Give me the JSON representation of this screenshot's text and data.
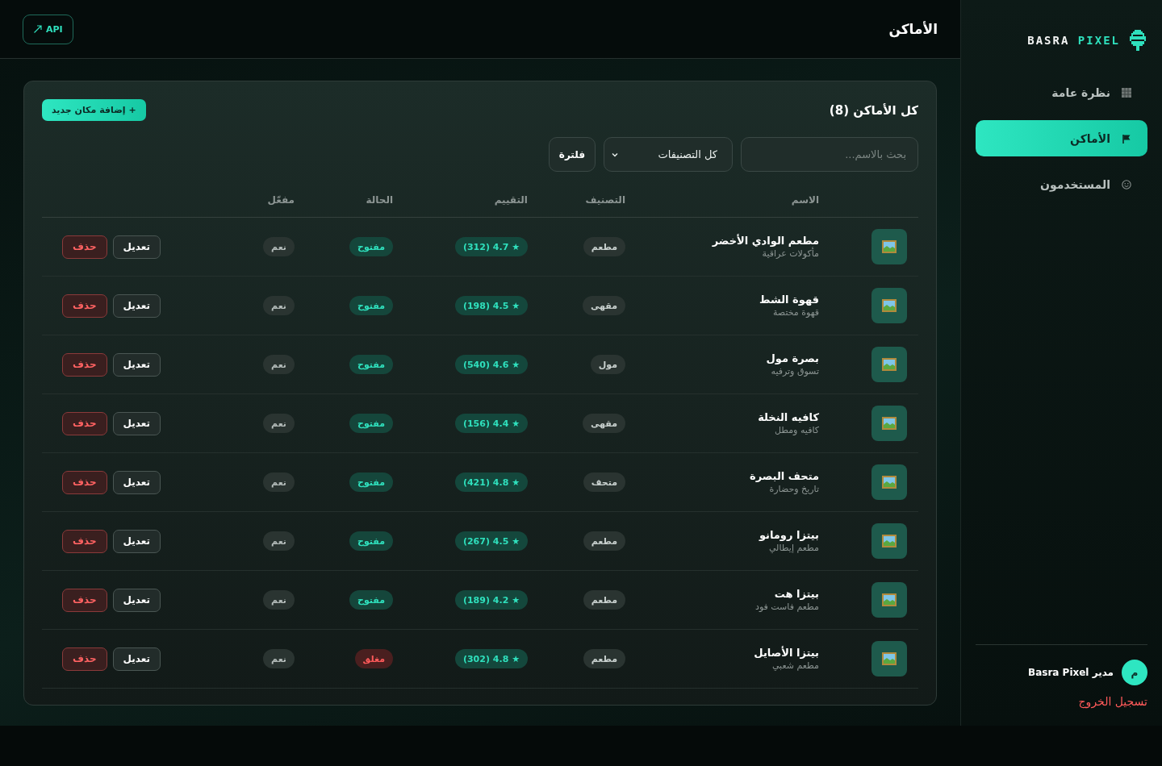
{
  "sidebar": {
    "logo": {
      "word_1": "BASRA",
      "word_2": "PIXEL"
    },
    "items": [
      {
        "label": "نظرة عامة",
        "selected": false
      },
      {
        "label": "الأماكن",
        "selected": true
      },
      {
        "label": "المستخدمون",
        "selected": false
      }
    ],
    "user": {
      "initial": "م",
      "name": "مدير Basra Pixel"
    },
    "logout": "تسجيل الخروج"
  },
  "header": {
    "title": "الأماكن",
    "api_button": "API"
  },
  "card": {
    "title": "كل الأماكن (8)",
    "add_button": "+ إضافة مكان جديد",
    "search": {
      "placeholder": "بحث بالاسم..."
    },
    "category_select": "كل التصنيفات",
    "filter_button": "فلترة",
    "columns": [
      "الاسم",
      "التصنيف",
      "التقييم",
      "الحالة",
      "مفعّل"
    ],
    "rows": [
      {
        "name": "مطعم الوادي الأخضر",
        "subtitle": "مأكولات عراقية",
        "category": "مطعم",
        "rating": "★ 4.7 (312)",
        "status": "مفتوح",
        "open": true,
        "featured": "نعم",
        "edit": "تعديل",
        "delete": "حذف"
      },
      {
        "name": "قهوة الشط",
        "subtitle": "قهوة مختصة",
        "category": "مقهى",
        "rating": "★ 4.5 (198)",
        "status": "مفتوح",
        "open": true,
        "featured": "نعم",
        "edit": "تعديل",
        "delete": "حذف"
      },
      {
        "name": "بصرة مول",
        "subtitle": "تسوق وترفيه",
        "category": "مول",
        "rating": "★ 4.6 (540)",
        "status": "مفتوح",
        "open": true,
        "featured": "نعم",
        "edit": "تعديل",
        "delete": "حذف"
      },
      {
        "name": "كافيه النخلة",
        "subtitle": "كافيه ومطل",
        "category": "مقهى",
        "rating": "★ 4.4 (156)",
        "status": "مفتوح",
        "open": true,
        "featured": "نعم",
        "edit": "تعديل",
        "delete": "حذف"
      },
      {
        "name": "متحف البصرة",
        "subtitle": "تاريخ وحضارة",
        "category": "متحف",
        "rating": "★ 4.8 (421)",
        "status": "مفتوح",
        "open": true,
        "featured": "نعم",
        "edit": "تعديل",
        "delete": "حذف"
      },
      {
        "name": "بيتزا رومانو",
        "subtitle": "مطعم إيطالي",
        "category": "مطعم",
        "rating": "★ 4.5 (267)",
        "status": "مفتوح",
        "open": true,
        "featured": "نعم",
        "edit": "تعديل",
        "delete": "حذف"
      },
      {
        "name": "بيتزا هت",
        "subtitle": "مطعم فاست فود",
        "category": "مطعم",
        "rating": "★ 4.2 (189)",
        "status": "مفتوح",
        "open": true,
        "featured": "نعم",
        "edit": "تعديل",
        "delete": "حذف"
      },
      {
        "name": "بيتزا الأصايل",
        "subtitle": "مطعم شعبي",
        "category": "مطعم",
        "rating": "★ 4.8 (302)",
        "status": "مغلق",
        "open": false,
        "featured": "نعم",
        "edit": "تعديل",
        "delete": "حذف"
      }
    ]
  }
}
